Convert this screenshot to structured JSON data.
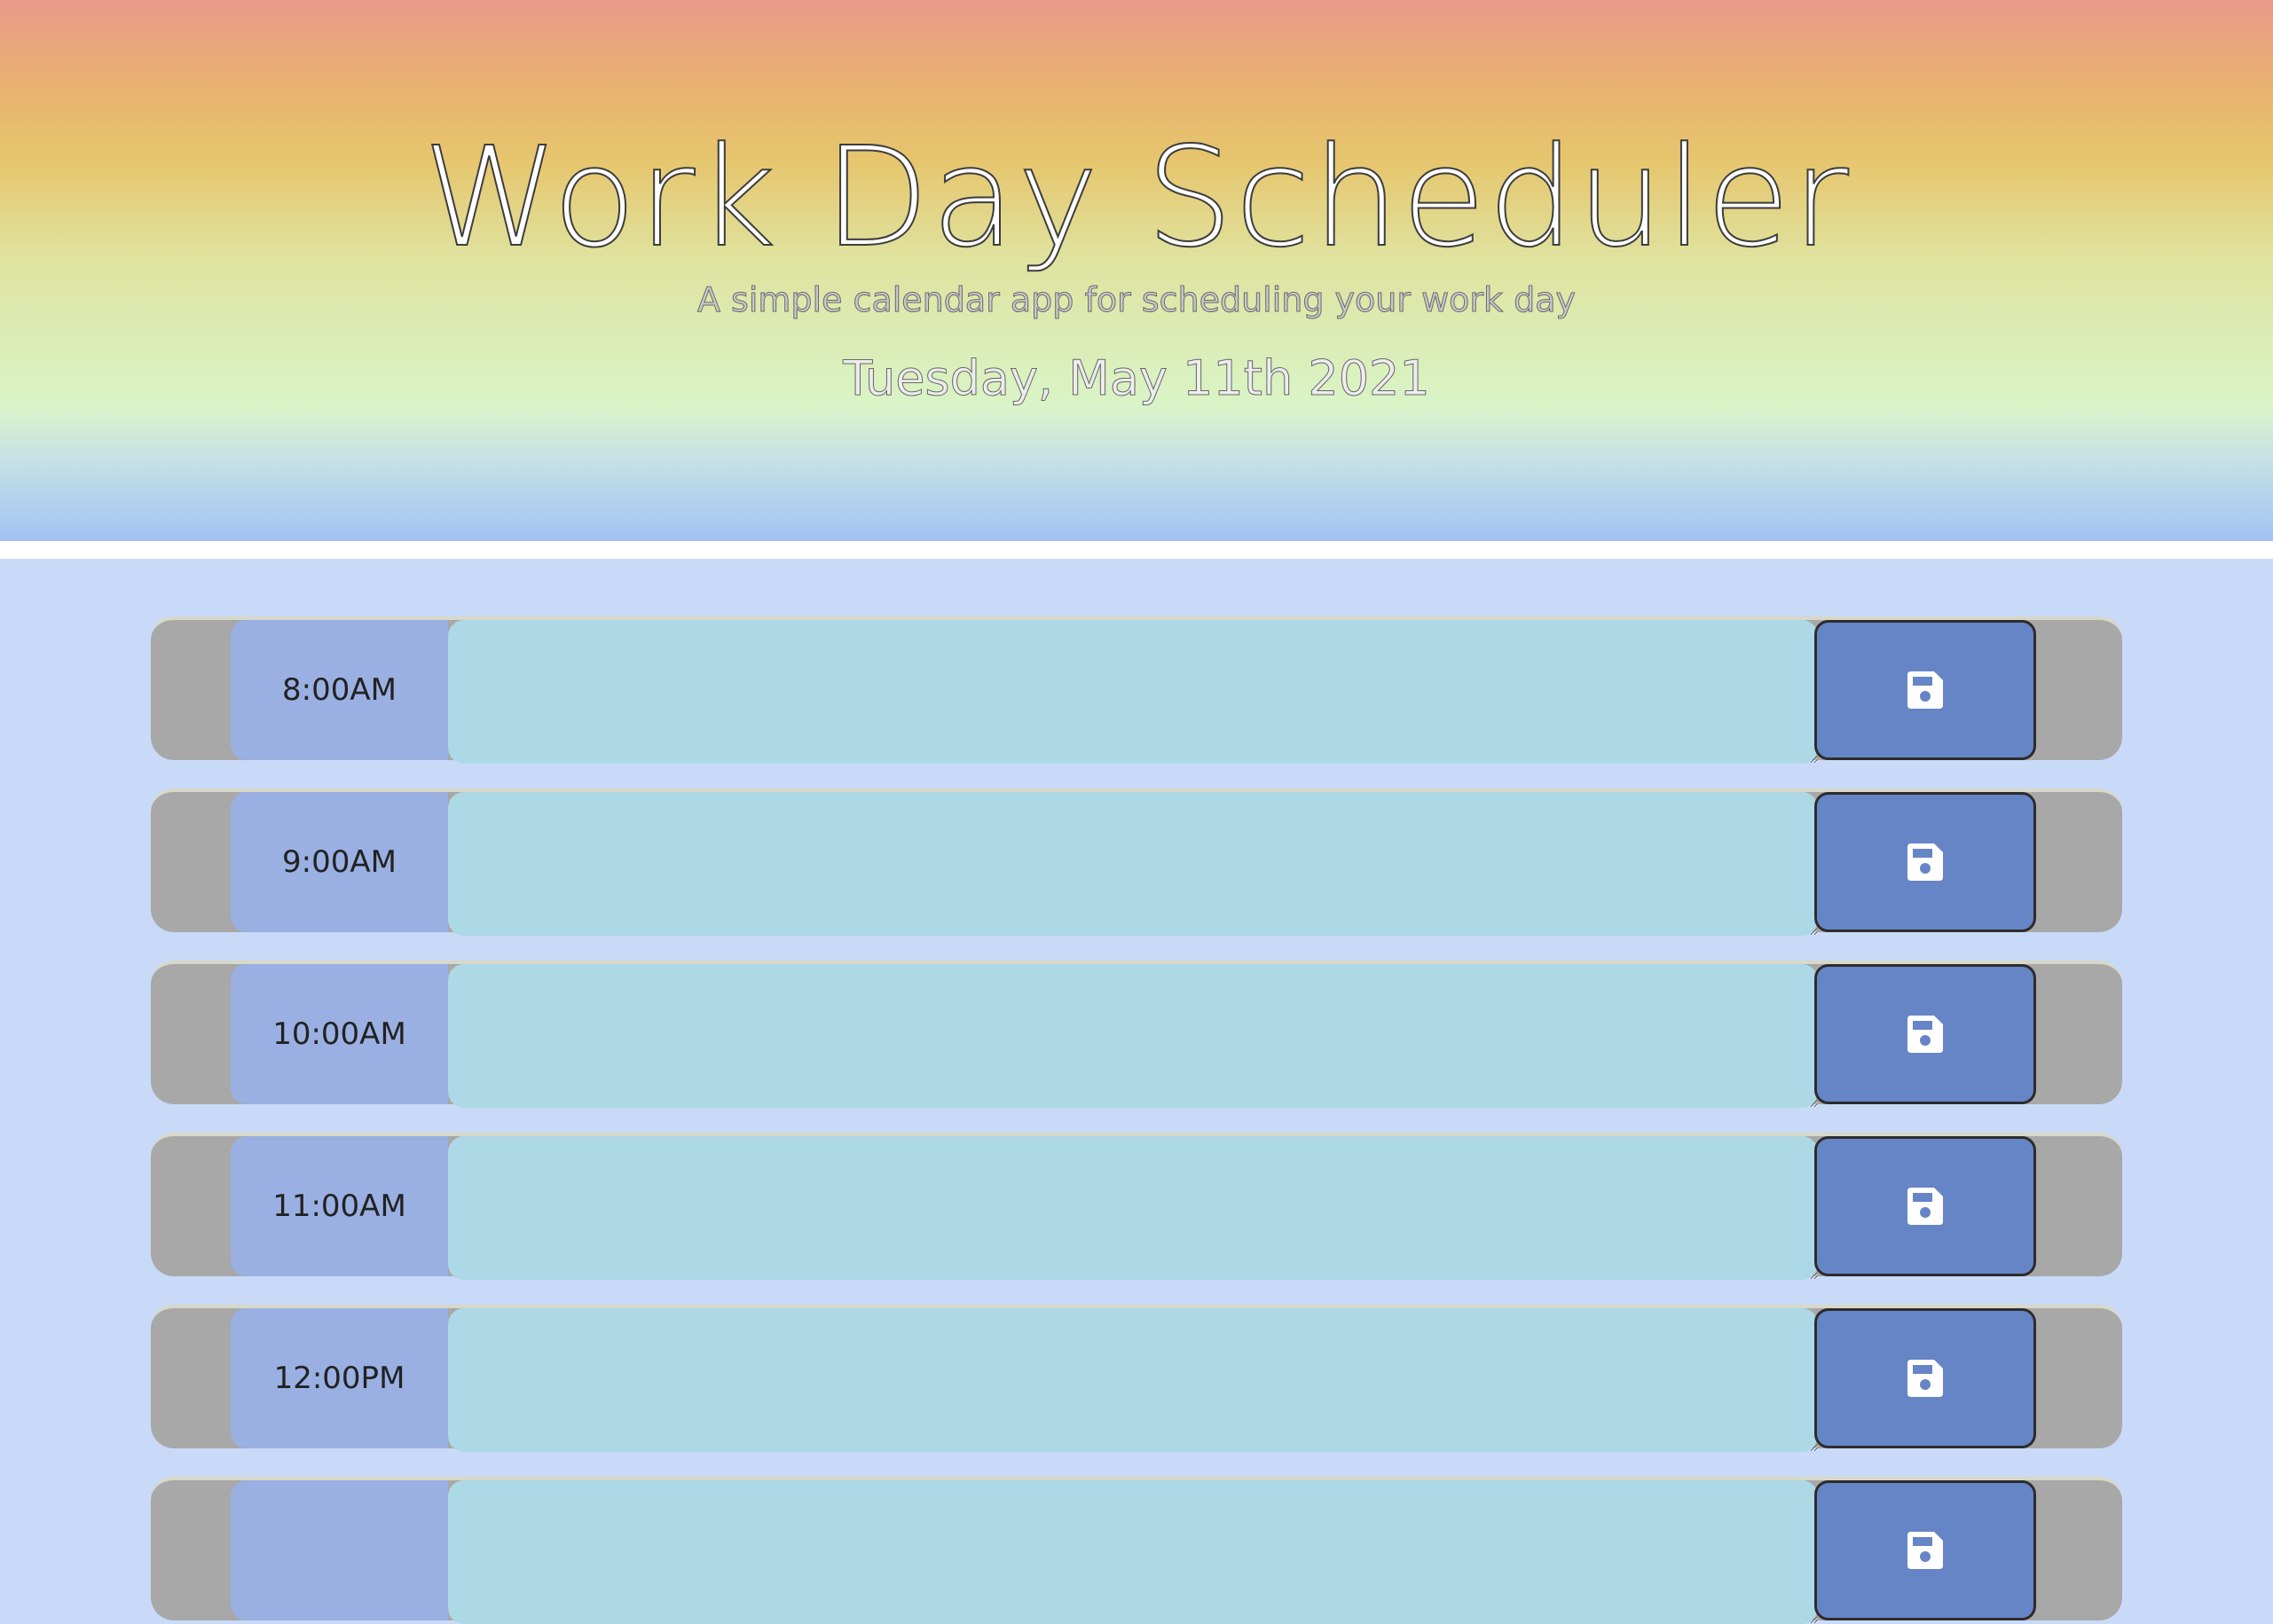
{
  "header": {
    "title": "Work Day Scheduler",
    "subtitle": "A simple calendar app for scheduling your work day",
    "current_date": "Tuesday, May 11th 2021"
  },
  "schedule": {
    "rows": [
      {
        "hour": "8:00AM",
        "description": "",
        "save_icon": "floppy-disk-icon"
      },
      {
        "hour": "9:00AM",
        "description": "",
        "save_icon": "floppy-disk-icon"
      },
      {
        "hour": "10:00AM",
        "description": "",
        "save_icon": "floppy-disk-icon"
      },
      {
        "hour": "11:00AM",
        "description": "",
        "save_icon": "floppy-disk-icon"
      },
      {
        "hour": "12:00PM",
        "description": "",
        "save_icon": "floppy-disk-icon"
      },
      {
        "hour": "",
        "description": "",
        "save_icon": "floppy-disk-icon"
      }
    ]
  },
  "colors": {
    "page_background": "#c9daf8",
    "hour_cell": "#9ab0e2",
    "description_cell": "#add8e6",
    "save_button": "#6685c6",
    "row_background": "#a8a8a8"
  }
}
